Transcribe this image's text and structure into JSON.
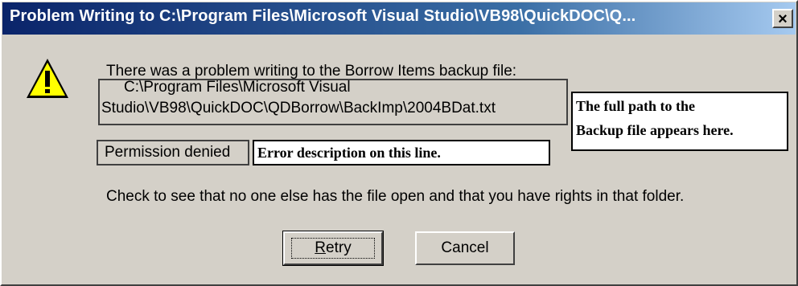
{
  "dialog": {
    "title": "Problem Writing to C:\\Program Files\\Microsoft Visual Studio\\VB98\\QuickDOC\\Q...",
    "close_glyph": "×",
    "icon": "warning-icon",
    "message": "There was a problem writing to the Borrow Items backup file:",
    "path_line1": "C:\\Program Files\\Microsoft Visual",
    "path_line2": "Studio\\VB98\\QuickDOC\\QDBorrow\\BackImp\\2004BDat.txt",
    "error": "Permission denied",
    "advice": "Check to see that no one else has the file open and that you have rights in that folder.",
    "retry_prefix": "",
    "retry_accel": "R",
    "retry_rest": "etry",
    "cancel_label": "Cancel"
  },
  "annotations": {
    "path_note_line1": "The full path to the",
    "path_note_line2": "Backup file appears here.",
    "error_note": "Error description on this line."
  }
}
